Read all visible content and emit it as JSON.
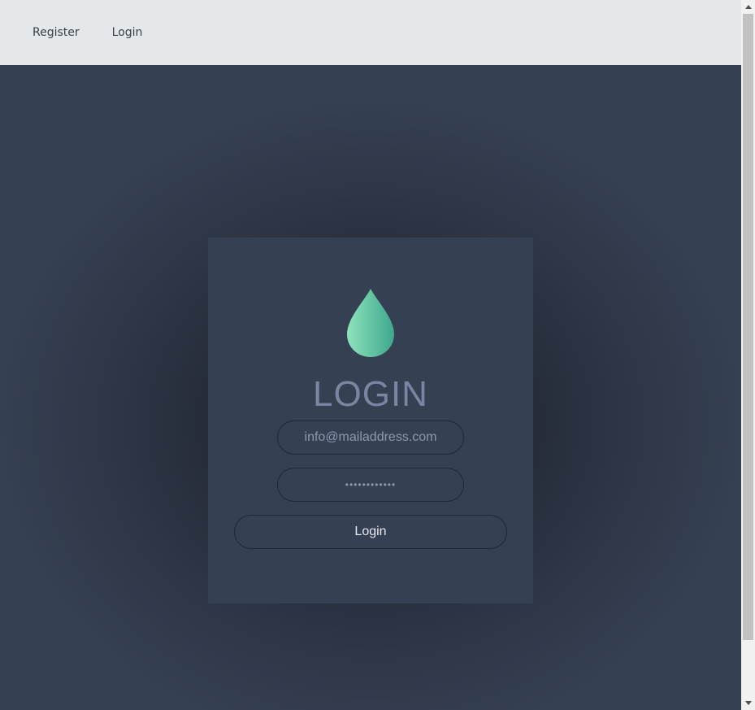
{
  "nav": {
    "items": [
      {
        "label": "Register"
      },
      {
        "label": "Login"
      }
    ]
  },
  "login_card": {
    "icon": "water-drop-icon",
    "title": "LOGIN",
    "email": {
      "placeholder": "info@mailaddress.com",
      "value": ""
    },
    "password": {
      "placeholder": "••••••••••••",
      "value": ""
    },
    "submit_label": "Login"
  },
  "colors": {
    "navbar_bg": "#e5e8ea",
    "page_bg": "#354052",
    "card_bg": "#354052",
    "title": "#7a86a1",
    "drop_gradient_start": "#8de3bb",
    "drop_gradient_end": "#3fa78e"
  }
}
